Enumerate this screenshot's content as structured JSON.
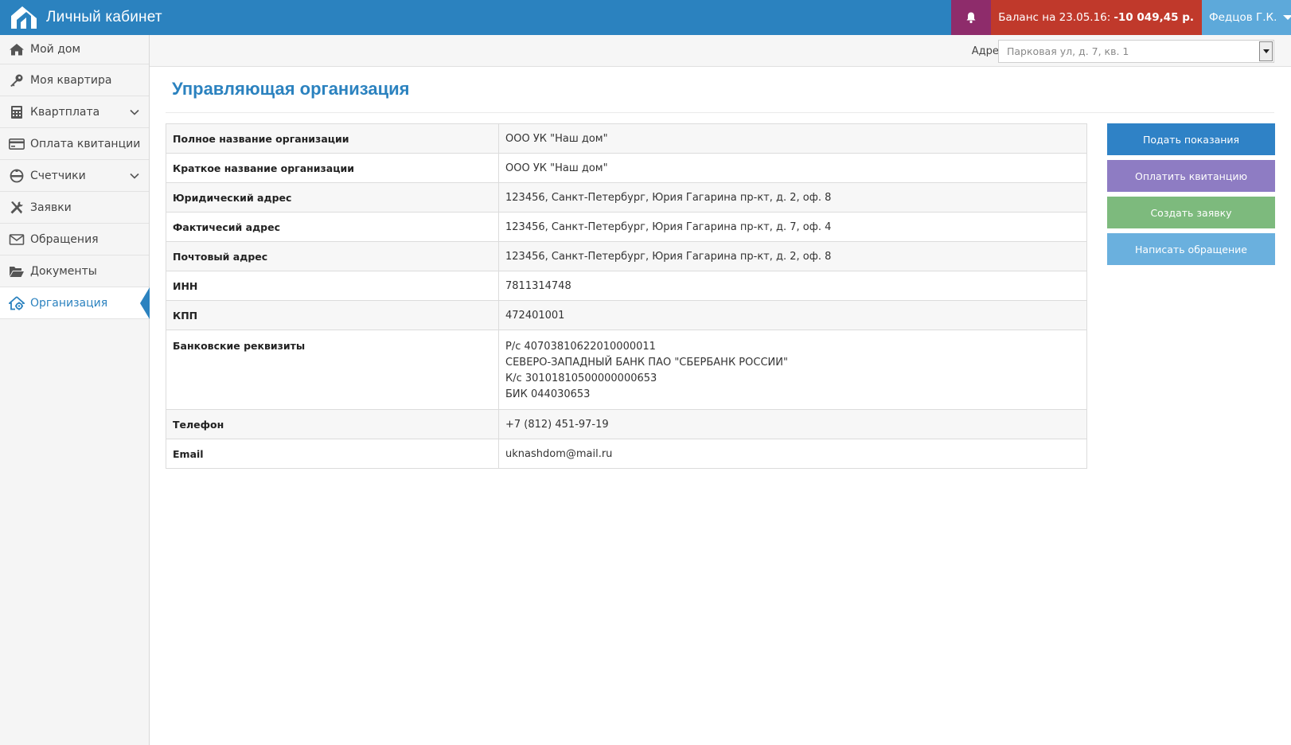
{
  "header": {
    "title": "Личный кабинет",
    "balance_label": "Баланс на 23.05.16:",
    "balance_value": "-10 049,45 р.",
    "user_name": "Федцов Г.К."
  },
  "sidebar": {
    "items": [
      {
        "label": "Мой дом",
        "icon": "home-icon"
      },
      {
        "label": "Моя квартира",
        "icon": "key-icon"
      },
      {
        "label": "Квартплата",
        "icon": "calculator-icon",
        "expandable": true
      },
      {
        "label": "Оплата квитанции",
        "icon": "credit-card-icon"
      },
      {
        "label": "Счетчики",
        "icon": "meter-icon",
        "expandable": true
      },
      {
        "label": "Заявки",
        "icon": "tools-icon"
      },
      {
        "label": "Обращения",
        "icon": "envelope-icon"
      },
      {
        "label": "Документы",
        "icon": "folder-icon"
      },
      {
        "label": "Организация",
        "icon": "house-gear-icon",
        "active": true
      }
    ]
  },
  "address": {
    "label": "Адрес",
    "selected": "Парковая ул, д. 7, кв. 1"
  },
  "page": {
    "title": "Управляющая организация"
  },
  "org_table": {
    "rows": [
      {
        "key": "Полное название организации",
        "value": "ООО УК \"Наш дом\""
      },
      {
        "key": "Краткое название организации",
        "value": "ООО УК \"Наш дом\""
      },
      {
        "key": "Юридический адрес",
        "value": "123456, Санкт-Петербург, Юрия Гагарина пр-кт, д. 2, оф. 8"
      },
      {
        "key": "Фактичесий адрес",
        "value": "123456, Санкт-Петербург, Юрия Гагарина пр-кт, д. 7, оф. 4"
      },
      {
        "key": "Почтовый адрес",
        "value": "123456, Санкт-Петербург, Юрия Гагарина пр-кт, д. 2, оф. 8"
      },
      {
        "key": "ИНН",
        "value": "7811314748"
      },
      {
        "key": "КПП",
        "value": "472401001"
      },
      {
        "key": "Банковские реквизиты",
        "lines": [
          "Р/с 40703810622010000011",
          "СЕВЕРО-ЗАПАДНЫЙ БАНК ПАО \"СБЕРБАНК РОССИИ\"",
          "К/с 30101810500000000653",
          "БИК 044030653"
        ]
      },
      {
        "key": "Телефон",
        "value": "+7 (812) 451-97-19"
      },
      {
        "key": "Email",
        "value": "uknashdom@mail.ru"
      }
    ]
  },
  "actions": {
    "submit_readings": "Подать показания",
    "pay_receipt": "Оплатить квитанцию",
    "create_request": "Создать заявку",
    "write_appeal": "Написать обращение"
  },
  "colors": {
    "brand": "#2b82bf",
    "bell_bg": "#8e2c6b",
    "balance_bg": "#c0392b",
    "user_bg": "#5da9da",
    "btn_submit": "#2f82c6",
    "btn_pay": "#8e7cc3",
    "btn_create": "#7dba7d",
    "btn_write": "#6ab0de"
  }
}
